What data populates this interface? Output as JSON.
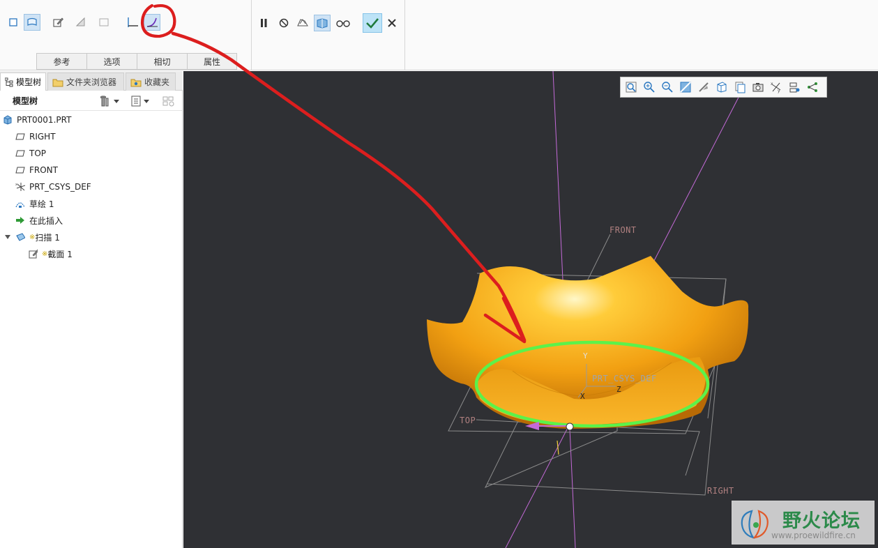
{
  "ribbon": {
    "tabs": [
      {
        "label": "参考"
      },
      {
        "label": "选项"
      },
      {
        "label": "相切"
      },
      {
        "label": "属性"
      }
    ]
  },
  "panel": {
    "tabs": [
      {
        "label": "模型树"
      },
      {
        "label": "文件夹浏览器"
      },
      {
        "label": "收藏夹"
      }
    ],
    "tree_title": "模型树"
  },
  "tree": {
    "items": [
      {
        "label": "PRT0001.PRT",
        "icon": "part-icon"
      },
      {
        "label": "RIGHT",
        "icon": "datum-plane-icon"
      },
      {
        "label": "TOP",
        "icon": "datum-plane-icon"
      },
      {
        "label": "FRONT",
        "icon": "datum-plane-icon"
      },
      {
        "label": "PRT_CSYS_DEF",
        "icon": "coordinate-system-icon"
      },
      {
        "label": "草绘 1",
        "icon": "sketch-icon"
      },
      {
        "label": "在此插入",
        "icon": "insert-here-arrow-icon"
      },
      {
        "label": "扫描 1",
        "icon": "sweep-icon",
        "prefix": "※"
      },
      {
        "label": "截面 1",
        "icon": "section-icon",
        "prefix": "※"
      }
    ]
  },
  "viewport": {
    "labels": {
      "front": "FRONT",
      "top": "TOP",
      "right": "RIGHT",
      "csys": "PRT_CSYS_DEF",
      "axis_y": "Y",
      "axis_z": "Z",
      "axis_x": "X"
    },
    "colors": {
      "background": "#2f3034",
      "surface": "#f4a71a",
      "trajectory": "#5cf24a",
      "annotation": "#dc1e1e",
      "datum_axis": "#c46ad8"
    }
  },
  "watermark": {
    "title": "野火论坛",
    "url": "www.proewildfire.cn"
  }
}
